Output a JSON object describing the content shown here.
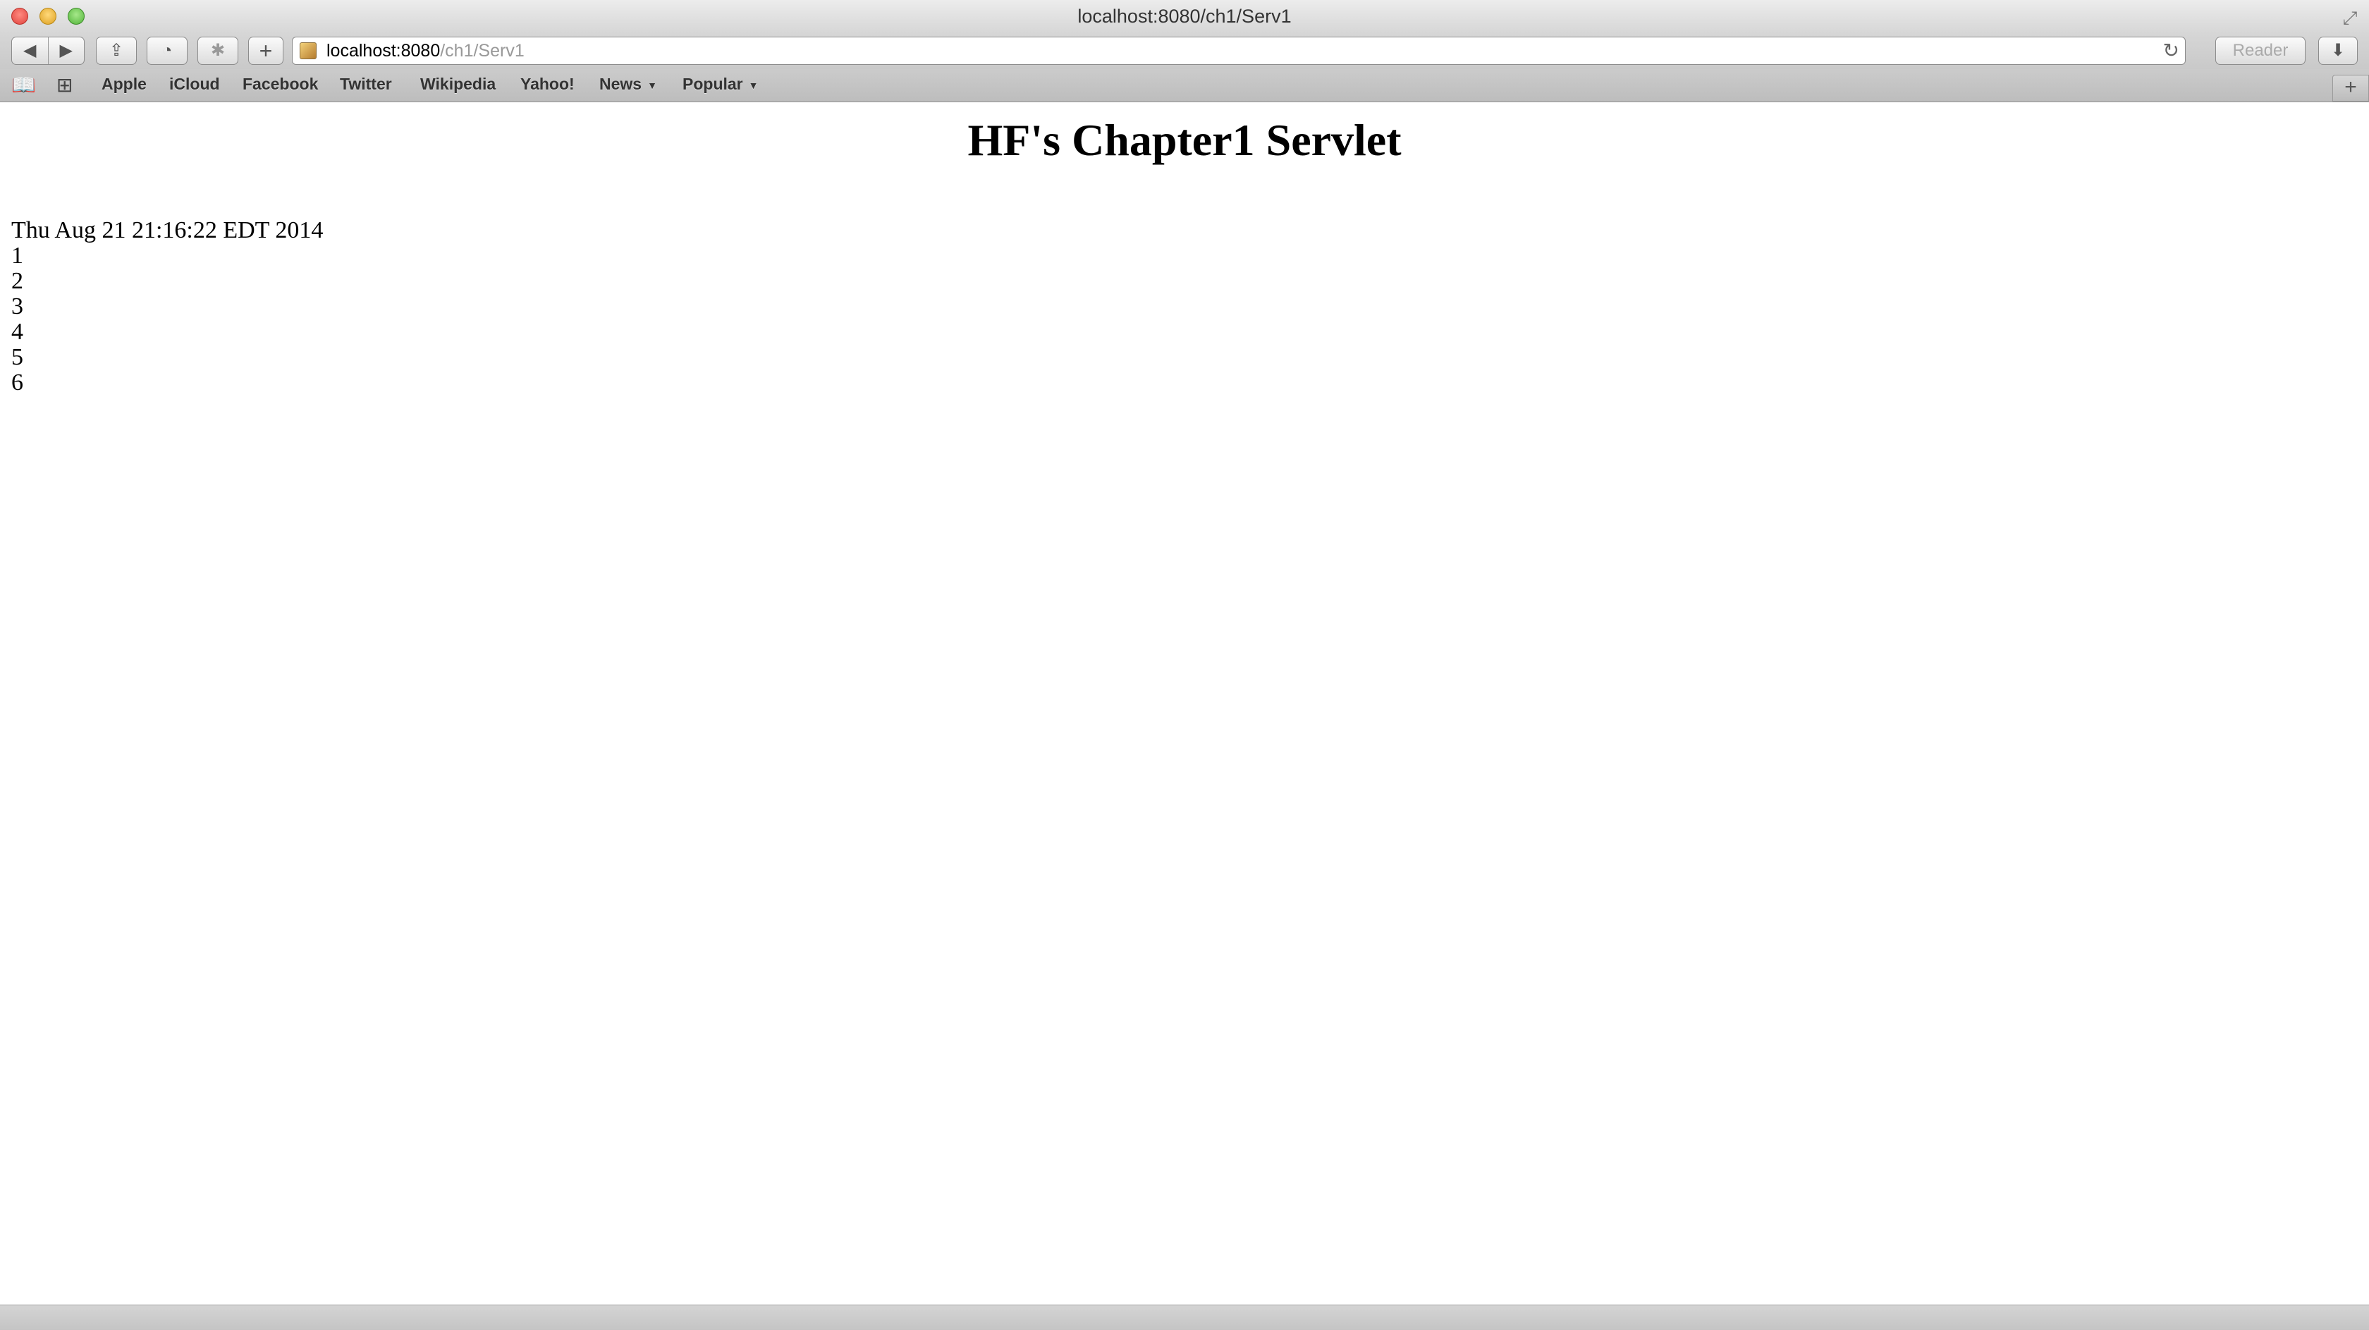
{
  "window": {
    "title": "localhost:8080/ch1/Serv1"
  },
  "toolbar": {
    "back_icon": "◀",
    "forward_icon": "▶",
    "share_icon": "⇪",
    "history_icon": "◔",
    "extension_icon": "✱",
    "add_icon": "+",
    "url_host": "localhost:8080",
    "url_path": "/ch1/Serv1",
    "reload_icon": "↻",
    "reader_label": "Reader",
    "download_icon": "⬇"
  },
  "bookmarks": {
    "reading_list_icon": "📖",
    "top_sites_icon": "⊞",
    "items": [
      {
        "label": "Apple"
      },
      {
        "label": "iCloud"
      },
      {
        "label": "Facebook"
      },
      {
        "label": "Twitter"
      },
      {
        "label": "Wikipedia"
      },
      {
        "label": "Yahoo!"
      },
      {
        "label": "News"
      },
      {
        "label": "Popular"
      }
    ],
    "newtab_icon": "+"
  },
  "page": {
    "heading": "HF's Chapter1 Servlet",
    "timestamp": "Thu Aug 21 21:16:22 EDT 2014",
    "lines": [
      "1",
      "2",
      "3",
      "4",
      "5",
      "6"
    ]
  }
}
